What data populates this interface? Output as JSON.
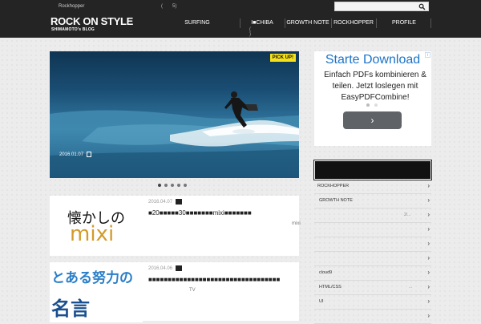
{
  "header": {
    "tagline": "Rockhopper",
    "top_brackets": [
      "(",
      "5)"
    ],
    "logo": "ROCK ON STYLE",
    "logo_sub": "SHIMAMOTO's BLOG",
    "search": {
      "placeholder": "",
      "value": ""
    },
    "nav": [
      {
        "label": "SURFING",
        "sub": ""
      },
      {
        "label": "I■CHIBA",
        "sub": "( )"
      },
      {
        "label": "GROWTH NOTE",
        "sub": ""
      },
      {
        "label": "ROCKHOPPER",
        "sub": ""
      },
      {
        "label": "PROFILE",
        "sub": ""
      }
    ]
  },
  "slider": {
    "badge": "PICK UP!",
    "date": "2016.01.07",
    "dots": 5,
    "active_dot": 0
  },
  "posts": [
    {
      "date": "2016.04.07",
      "title": "■20■■■■■30■■■■■■■mixi■■■■■■■",
      "excerpt": "mixi",
      "thumb_line1": "懐かしの",
      "thumb_line2": "mixi"
    },
    {
      "date": "2016.04.06",
      "title": "■■■■■■■■■■■■■■■■■■■■■■■■■■■■■■■■■■",
      "excerpt": "TV",
      "thumb_line1": "とある努力の",
      "thumb_line2": "名言"
    }
  ],
  "ad": {
    "title": "Starte Download",
    "body": "Einfach PDFs kombinieren & teilen. Jetzt loslegen mit EasyPDFCombine!",
    "info": "i",
    "button": "›",
    "colors": {
      "title": "#1a73c8",
      "button": "#5f6368"
    }
  },
  "sidebar": {
    "widget_title": "",
    "categories": [
      {
        "label": "ROCKHOPPER",
        "count": ""
      },
      {
        "label": "GROWTH NOTE",
        "count": ""
      },
      {
        "label": "",
        "count": "2/..."
      },
      {
        "label": "",
        "count": ""
      },
      {
        "label": "",
        "count": ""
      },
      {
        "label": "",
        "count": ""
      },
      {
        "label": "",
        "count": ""
      },
      {
        "label": "cloud9",
        "count": ""
      },
      {
        "label": "HTML/CSS",
        "count": "..."
      },
      {
        "label": "UI",
        "count": ""
      },
      {
        "label": "",
        "count": ""
      }
    ]
  },
  "colors": {
    "header_bg": "#242424",
    "page_bg": "#ececec",
    "badge": "#f5e11a"
  }
}
